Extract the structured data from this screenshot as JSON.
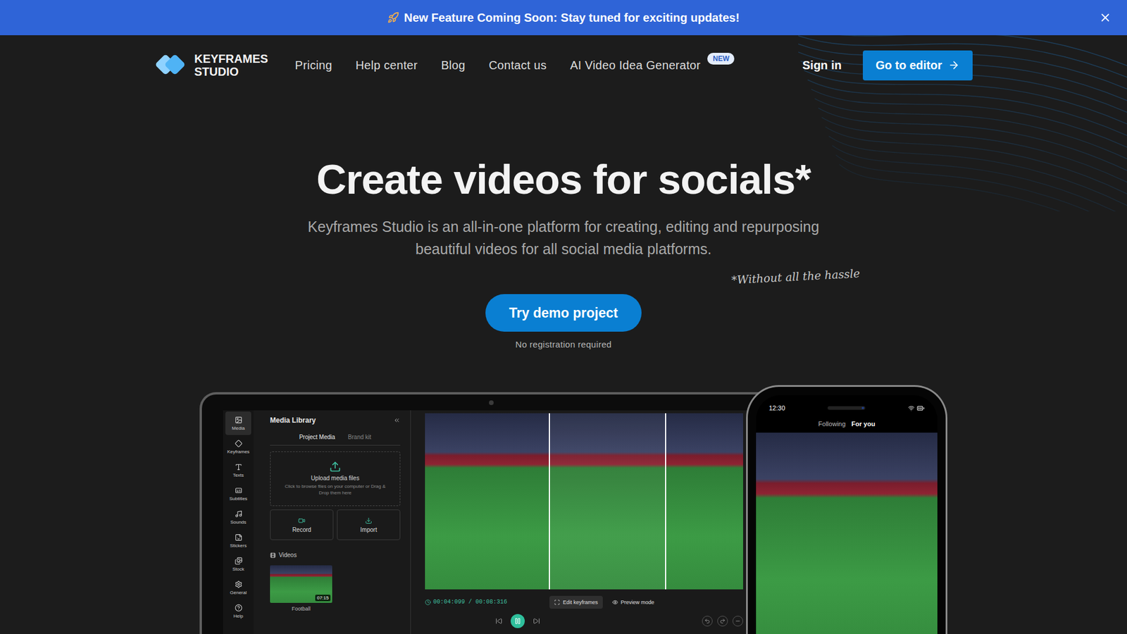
{
  "banner": {
    "title": "New Feature Coming Soon:",
    "text": "Stay tuned for exciting updates!"
  },
  "logo": {
    "line1": "KEYFRAMES",
    "line2": "STUDIO"
  },
  "nav": [
    {
      "label": "Pricing"
    },
    {
      "label": "Help center"
    },
    {
      "label": "Blog"
    },
    {
      "label": "Contact us"
    },
    {
      "label": "AI Video Idea Generator",
      "badge": "NEW"
    }
  ],
  "signIn": "Sign in",
  "editorButton": "Go to editor",
  "hero": {
    "title": "Create videos for socials*",
    "subtitleLines": [
      "Keyframes Studio is an all-in-one platform for creating, editing and repurposing",
      "beautiful videos for all social media platforms."
    ],
    "note": "*Without all the hassle",
    "cta": "Try demo project",
    "ctaNote": "No registration required"
  },
  "editor": {
    "sidebar": [
      {
        "label": "Media",
        "selected": true
      },
      {
        "label": "Keyframes",
        "selected": false
      },
      {
        "label": "Texts",
        "selected": false
      },
      {
        "label": "Subtitles",
        "selected": false
      },
      {
        "label": "Sounds",
        "selected": false
      },
      {
        "label": "Stickers",
        "selected": false
      },
      {
        "label": "Stock",
        "selected": false
      },
      {
        "label": "General",
        "selected": false
      },
      {
        "label": "Help",
        "selected": false
      }
    ],
    "panelTitle": "Media Library",
    "tabs": [
      {
        "label": "Project Media",
        "selected": true
      },
      {
        "label": "Brand kit",
        "selected": false
      }
    ],
    "upload": {
      "title": "Upload media files",
      "hint": "Click to browse files on your computer or Drag & Drop them here"
    },
    "actions": [
      {
        "label": "Record"
      },
      {
        "label": "Import"
      }
    ],
    "section": "Videos",
    "videos": [
      {
        "name": "Football",
        "duration": "07:15"
      }
    ],
    "timecode": "00:04:099 / 00:08:316",
    "toolbar": [
      {
        "label": "Edit keyframes",
        "selected": true
      },
      {
        "label": "Preview mode",
        "selected": false
      }
    ],
    "playing": true
  },
  "phone": {
    "time": "12:30",
    "tabs": [
      {
        "label": "Following",
        "selected": false
      },
      {
        "label": "For you",
        "selected": true
      }
    ]
  }
}
